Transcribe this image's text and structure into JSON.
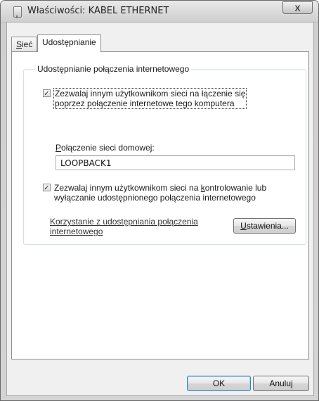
{
  "window": {
    "title": "Właściwości: KABEL ETHERNET",
    "close_label": "X"
  },
  "tabs": [
    {
      "label": "Sieć",
      "underline": "S",
      "rest": "ieć",
      "active": false
    },
    {
      "label": "Udostępnianie",
      "underline": "",
      "rest": "Udostępnianie",
      "active": true
    }
  ],
  "sharing": {
    "group_title": "Udostępnianie połączenia internetowego",
    "allow_connect": {
      "checked": true,
      "check_glyph": "✓",
      "line1": "Zezwalaj innym użytkownikom sieci na łączenie się",
      "line2": "poprzez połączenie internetowe tego komputera"
    },
    "home_connection": {
      "label_ul": "P",
      "label_rest": "ołączenie sieci domowej:",
      "value": "LOOPBACK1"
    },
    "allow_control": {
      "checked": true,
      "check_glyph": "✓",
      "line1_a": "Zezwalaj innym użytkownikom sieci na ",
      "line1_ul": "k",
      "line1_b": "ontrolowanie lub",
      "line2": "wyłączanie udostępnionego połączenia internetowego"
    },
    "help_link_line1": "Korzystanie z udostępniania połączenia",
    "help_link_line2": "internetowego",
    "settings_ul": "U",
    "settings_rest": "stawienia..."
  },
  "footer": {
    "ok_label": "OK",
    "cancel_label": "Anuluj"
  }
}
